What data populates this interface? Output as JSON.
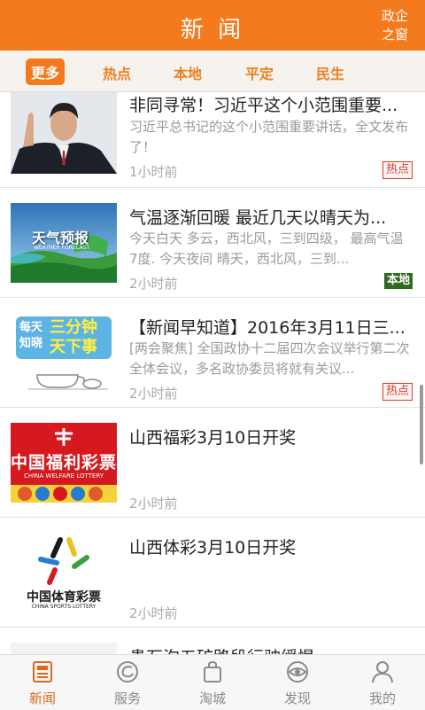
{
  "header": {
    "title": "新 闻",
    "right_link": "政企之窗"
  },
  "categories": [
    {
      "label": "更多",
      "active": true
    },
    {
      "label": "热点"
    },
    {
      "label": "本地"
    },
    {
      "label": "平定"
    },
    {
      "label": "民生"
    }
  ],
  "news": [
    {
      "title": "非同寻常！习近平这个小范围重要...",
      "summary": "习近平总书记的这个小范围重要讲话，全文发布了！",
      "time": "1小时前",
      "tag": "热点"
    },
    {
      "title": "气温逐渐回暖 最近几天以晴天为...",
      "summary": "今天白天 多云，西北风，三到四级， 最高气温 7度. 今天夜间 晴天，西北风，三到...",
      "time": "2小时前",
      "tag": "本地",
      "thumb_text": "天气预报",
      "thumb_text_en": "WEATHER FORECAST"
    },
    {
      "title": "【新闻早知道】2016年3月11日三...",
      "summary": "[两会聚焦] 全国政协十二届四次会议举行第二次全体会议，多名政协委员将就有关议...",
      "time": "2小时前",
      "tag": "热点",
      "thumb_text": [
        "每天",
        "知晓",
        "三分钟",
        "天下事"
      ]
    },
    {
      "title": "山西福彩3月10日开奖",
      "summary": "",
      "time": "2小时前",
      "thumb_text": "中国福利彩票",
      "thumb_text_en": "CHINA WELFARE LOTTERY"
    },
    {
      "title": "山西体彩3月10日开奖",
      "summary": "",
      "time": "2小时前",
      "thumb_text": "中国体育彩票",
      "thumb_text_en": "CHINA SPORTS LOTTERY"
    },
    {
      "title": "贵石沟五矿路段行驶缓慢",
      "summary": "",
      "time": "",
      "tag": ""
    }
  ],
  "tabs": [
    {
      "label": "新闻",
      "icon": "news-icon",
      "active": true
    },
    {
      "label": "服务",
      "icon": "service-icon"
    },
    {
      "label": "淘城",
      "icon": "shopping-bag-icon"
    },
    {
      "label": "发现",
      "icon": "discover-icon"
    },
    {
      "label": "我的",
      "icon": "user-icon"
    }
  ],
  "colors": {
    "brand": "#f47a1e",
    "hot_tag": "#d63a2a",
    "local_tag": "#2e6a24"
  }
}
